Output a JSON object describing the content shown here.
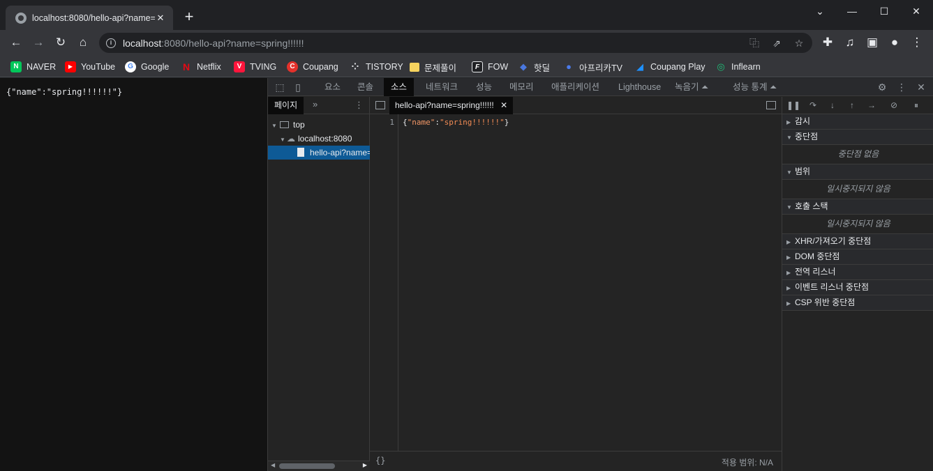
{
  "browser": {
    "tab_title": "localhost:8080/hello-api?name=",
    "tab_close": "✕",
    "new_tab": "+",
    "window_controls": [
      "⌄",
      "—",
      "☐",
      "✕"
    ],
    "url_host": "localhost",
    "url_rest": ":8080/hello-api?name=spring!!!!!!",
    "toolbar_icons": [
      "back-icon",
      "forward-icon",
      "reload-icon",
      "home-icon",
      "translate-icon",
      "share-icon",
      "star-icon",
      "extensions-icon",
      "media-icon",
      "sidepanel-icon",
      "profile-icon",
      "menu-icon"
    ]
  },
  "bookmarks": [
    {
      "label": "NAVER",
      "icon": "N",
      "color": "#03c75a"
    },
    {
      "label": "YouTube",
      "icon": "▶",
      "color": "#ff0000"
    },
    {
      "label": "Google",
      "icon": "G",
      "color": "#4285f4"
    },
    {
      "label": "Netflix",
      "icon": "N",
      "color": "#e50914"
    },
    {
      "label": "TVING",
      "icon": "V",
      "color": "#ff153c"
    },
    {
      "label": "Coupang",
      "icon": "C",
      "color": "#e4312b"
    },
    {
      "label": "TISTORY",
      "icon": "⁘",
      "color": "#35363a"
    },
    {
      "label": "문제풀이",
      "icon": "",
      "color": "#f6d35e"
    },
    {
      "label": "FOW",
      "icon": "F",
      "color": "#202124"
    },
    {
      "label": "핫딜",
      "icon": "◆",
      "color": "#2b59c3"
    },
    {
      "label": "아프리카TV",
      "icon": "●",
      "color": "#4b7bec"
    },
    {
      "label": "Coupang Play",
      "icon": "◢",
      "color": "#1e90ff"
    },
    {
      "label": "Inflearn",
      "icon": "◎",
      "color": "#1dc078"
    }
  ],
  "page": {
    "body_text": "{\"name\":\"spring!!!!!!\"}"
  },
  "devtools": {
    "tabs": [
      "요소",
      "콘솔",
      "소스",
      "네트워크",
      "성능",
      "메모리",
      "애플리케이션",
      "Lighthouse",
      "녹음기 ⏶",
      "성능 통계 ⏶"
    ],
    "active_tab": "소스",
    "navigator": {
      "tab": "페이지",
      "more": "»",
      "tree": [
        "top",
        "localhost:8080",
        "hello-api?name=spring!!!!!!"
      ]
    },
    "editor": {
      "file_tab": "hello-api?name=spring!!!!!!",
      "line_number": "1",
      "code_open": "{",
      "code_key": "\"name\"",
      "code_colon": ":",
      "code_value": "\"spring!!!!!!\"",
      "code_close": "}",
      "format_button": "{}",
      "coverage": "적용 범위: N/A"
    },
    "sidebar": {
      "sections": [
        "감시",
        "중단점",
        "범위",
        "호출 스택",
        "XHR/가져오기 중단점",
        "DOM 중단점",
        "전역 리스너",
        "이벤트 리스너 중단점",
        "CSP 위반 중단점"
      ],
      "no_breakpoints": "중단점 없음",
      "not_paused_scope": "일시중지되지 않음",
      "not_paused_stack": "일시중지되지 않음"
    }
  }
}
